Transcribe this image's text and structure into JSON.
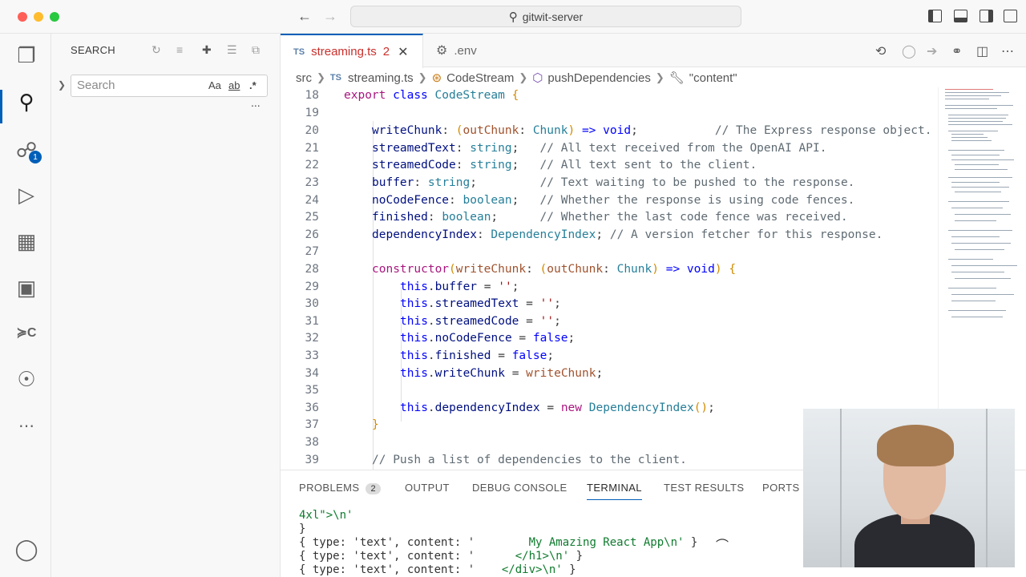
{
  "window": {
    "title": "gitwit-server"
  },
  "sidebar": {
    "title": "SEARCH",
    "search": {
      "placeholder": "Search",
      "value": ""
    },
    "options": {
      "match_case": "Aa",
      "whole_word": "ab",
      "regex": ".*"
    },
    "more": "..."
  },
  "tabs": [
    {
      "lang": "TS",
      "label": "streaming.ts",
      "problems": "2",
      "active": true
    },
    {
      "label": ".env",
      "active": false
    }
  ],
  "breadcrumb": [
    "src",
    "streaming.ts",
    "CodeStream",
    "pushDependencies",
    "\"content\""
  ],
  "breadcrumb_ts": "TS",
  "editor": {
    "lines": [
      {
        "n": "18"
      },
      {
        "n": "19"
      },
      {
        "n": "20"
      },
      {
        "n": "21"
      },
      {
        "n": "22"
      },
      {
        "n": "23"
      },
      {
        "n": "24"
      },
      {
        "n": "25"
      },
      {
        "n": "26"
      },
      {
        "n": "27"
      },
      {
        "n": "28"
      },
      {
        "n": "29"
      },
      {
        "n": "30"
      },
      {
        "n": "31"
      },
      {
        "n": "32"
      },
      {
        "n": "33"
      },
      {
        "n": "34"
      },
      {
        "n": "35"
      },
      {
        "n": "36"
      },
      {
        "n": "37"
      },
      {
        "n": "38"
      },
      {
        "n": "39"
      }
    ],
    "code": {
      "l18": [
        "export",
        "class",
        "CodeStream",
        "{"
      ],
      "l20": [
        "writeChunk",
        "outChunk",
        "Chunk",
        "void",
        "// The Express response object."
      ],
      "l21": [
        "streamedText",
        "string",
        "// All text received from the OpenAI API."
      ],
      "l22": [
        "streamedCode",
        "string",
        "// All text sent to the client."
      ],
      "l23": [
        "buffer",
        "string",
        "// Text waiting to be pushed to the response."
      ],
      "l24": [
        "noCodeFence",
        "boolean",
        "// Whether the response is using code fences."
      ],
      "l25": [
        "finished",
        "boolean",
        "// Whether the last code fence was received."
      ],
      "l26": [
        "dependencyIndex",
        "DependencyIndex",
        "// A version fetcher for this response."
      ],
      "l28": [
        "constructor",
        "writeChunk",
        "outChunk",
        "Chunk",
        "void"
      ],
      "l29": [
        "this",
        "buffer",
        "''"
      ],
      "l30": [
        "this",
        "streamedText",
        "''"
      ],
      "l31": [
        "this",
        "streamedCode",
        "''"
      ],
      "l32": [
        "this",
        "noCodeFence",
        "false"
      ],
      "l33": [
        "this",
        "finished",
        "false"
      ],
      "l34": [
        "this",
        "writeChunk",
        "writeChunk"
      ],
      "l36": [
        "this",
        "dependencyIndex",
        "new",
        "DependencyIndex"
      ],
      "l37": [
        "}"
      ],
      "l39": [
        "// Push a list of dependencies to the client."
      ]
    }
  },
  "panel": {
    "tabs": [
      "PROBLEMS",
      "OUTPUT",
      "DEBUG CONSOLE",
      "TERMINAL",
      "TEST RESULTS",
      "PORTS"
    ],
    "problems_count": "2",
    "terminal": {
      "l1": "4xl\">\\n'",
      "l2": "}",
      "prefix": "{ type: 'text', content: '",
      "s3": "        My Amazing React App\\n'",
      "e3": " }",
      "s4": "      </h1>\\n'",
      "e4": " }",
      "s5": "    </div>\\n'",
      "e5": " }"
    }
  },
  "colors": {
    "accent": "#005fb8",
    "badge": "#007acc",
    "keyword": "#a9167e"
  }
}
